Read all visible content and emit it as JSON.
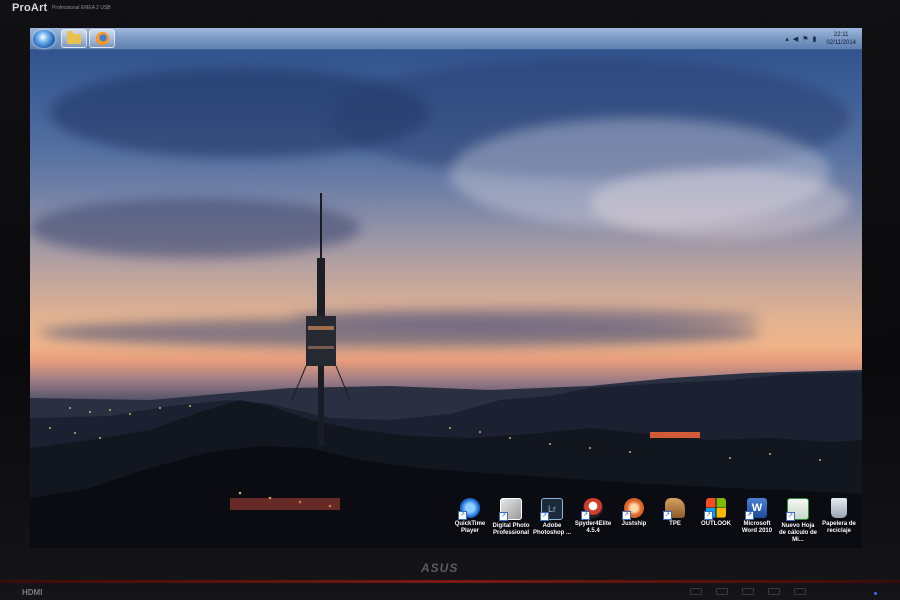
{
  "monitor": {
    "brand_top": "ProArt",
    "brand_tagline": "Professional EMEA 2 USB",
    "brand_bottom": "ASUS",
    "port_label": "HDMI"
  },
  "taskbar": {
    "start_icon": "windows-orb-icon",
    "pinned": [
      {
        "name": "explorer",
        "icon": "folder-icon"
      },
      {
        "name": "firefox",
        "icon": "firefox-icon"
      }
    ],
    "tray": {
      "icons": [
        "show-hidden-icon",
        "volume-icon",
        "flag-icon",
        "network-icon"
      ],
      "time": "22:11",
      "date": "02/11/2014"
    }
  },
  "desktop": {
    "wallpaper": "Collserola tower at dusk over city lights",
    "icons": [
      {
        "label": "QuickTime Player",
        "icon": "quicktime-icon",
        "color": "#1e6fd9"
      },
      {
        "label": "Digital Photo Professional",
        "icon": "dpp-icon",
        "color": "#c9c9c9"
      },
      {
        "label": "Adobe Photoshop ...",
        "icon": "lightroom-icon",
        "color": "#1c2b3a"
      },
      {
        "label": "Spyder4Elite 4.5.4",
        "icon": "spyder-icon",
        "color": "#d23a2a"
      },
      {
        "label": "Justship",
        "icon": "justship-icon",
        "color": "#e36a2a"
      },
      {
        "label": "TPE",
        "icon": "tpe-icon",
        "color": "#8a5a2a"
      },
      {
        "label": "OUTLOOK",
        "icon": "windows-logo-icon",
        "color": "#f25022"
      },
      {
        "label": "Microsoft Word 2010",
        "icon": "word-icon",
        "color": "#2b5fb4"
      },
      {
        "label": "Nuevo Hoja de cálculo de Mi...",
        "icon": "spreadsheet-icon",
        "color": "#2e8b3a"
      },
      {
        "label": "Papelera de reciclaje",
        "icon": "recycle-bin-icon",
        "color": "#bfc6cf"
      }
    ]
  }
}
